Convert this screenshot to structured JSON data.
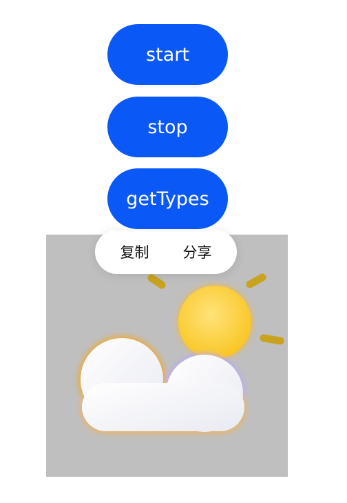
{
  "buttons": {
    "start_label": "start",
    "stop_label": "stop",
    "get_types_label": "getTypes"
  },
  "context_menu": {
    "copy_label": "复制",
    "share_label": "分享"
  },
  "image": {
    "icon": "partly-cloudy-icon",
    "background_color": "#bfbfbf"
  },
  "colors": {
    "button_bg": "#0a59f7",
    "button_text": "#ffffff",
    "sun": "#fbd338",
    "sun_rays": "#c9a220"
  }
}
